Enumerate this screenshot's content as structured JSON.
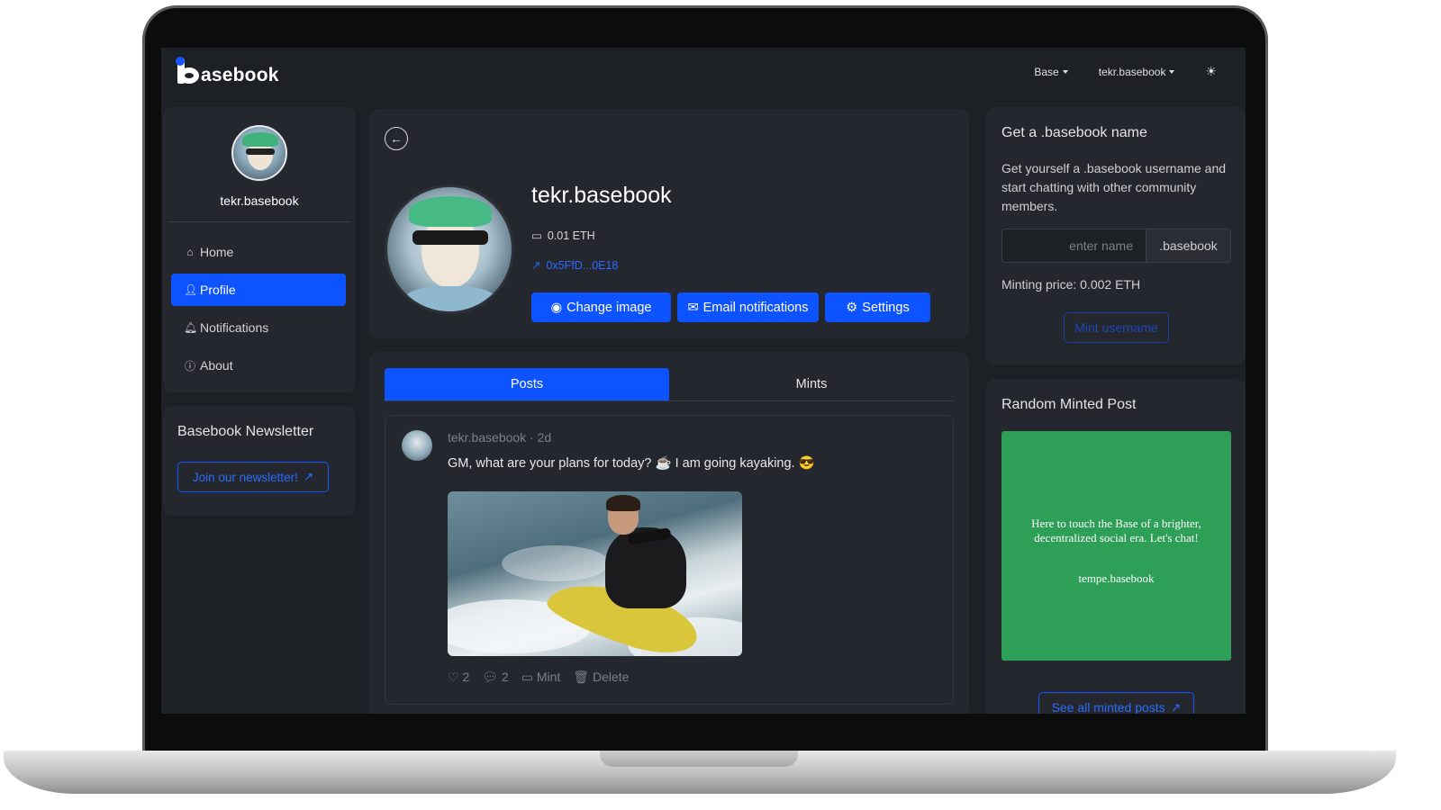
{
  "brand": {
    "logo_text": "asebook"
  },
  "topnav": {
    "network": "Base",
    "account": "tekr.basebook",
    "theme_icon": "sun-icon"
  },
  "sidebar": {
    "username": "tekr.basebook",
    "items": [
      {
        "label": "Home",
        "icon": "home-icon"
      },
      {
        "label": "Profile",
        "icon": "user-icon",
        "active": true
      },
      {
        "label": "Notifications",
        "icon": "bell-icon"
      },
      {
        "label": "About",
        "icon": "question-icon"
      }
    ]
  },
  "newsletter": {
    "title": "Basebook Newsletter",
    "button": "Join our newsletter!"
  },
  "profile": {
    "name": "tekr.basebook",
    "balance": "0.01 ETH",
    "address": "0x5FfD...0E18",
    "buttons": {
      "change_image": "Change image",
      "email": "Email notifications",
      "settings": "Settings"
    }
  },
  "tabs": {
    "posts": "Posts",
    "mints": "Mints"
  },
  "post": {
    "author": "tekr.basebook",
    "age": "2d",
    "text": "GM, what are your plans for today? ☕ I am going kayaking. 😎",
    "likes": "2",
    "comments": "2",
    "mint_label": "Mint",
    "delete_label": "Delete"
  },
  "name_card": {
    "title": "Get a .basebook name",
    "description": "Get yourself a .basebook username and start chatting with other community members.",
    "input_placeholder": "enter name",
    "suffix": ".basebook",
    "price": "Minting price: 0.002 ETH",
    "mint_button": "Mint username"
  },
  "random_card": {
    "title": "Random Minted Post",
    "nft_text": "Here to touch the Base of a brighter, decentralized social era. Let's chat!",
    "nft_author": "tempe.basebook",
    "nft_bg": "#2e9f57",
    "button": "See all minted posts"
  },
  "colors": {
    "accent": "#0d53ff",
    "link": "#2b6bff",
    "panel": "#24272d",
    "screen_bg": "#1d2025"
  }
}
